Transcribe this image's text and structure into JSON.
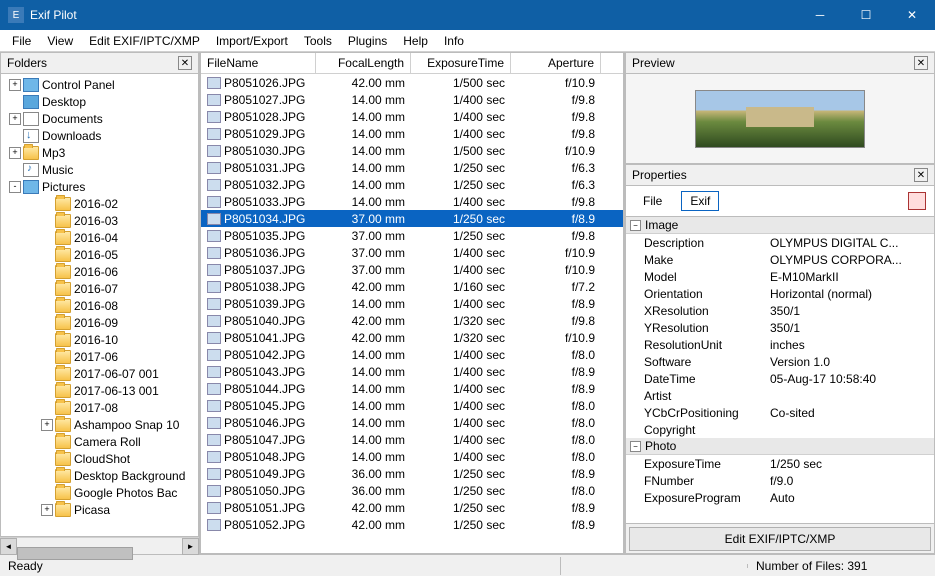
{
  "window": {
    "title": "Exif Pilot"
  },
  "menu": [
    "File",
    "View",
    "Edit EXIF/IPTC/XMP",
    "Import/Export",
    "Tools",
    "Plugins",
    "Help",
    "Info"
  ],
  "panels": {
    "folders_title": "Folders",
    "preview_title": "Preview",
    "properties_title": "Properties"
  },
  "tree": [
    {
      "depth": 0,
      "exp": "+",
      "icon": "cp",
      "label": "Control Panel"
    },
    {
      "depth": 0,
      "exp": "",
      "icon": "desk",
      "label": "Desktop"
    },
    {
      "depth": 0,
      "exp": "+",
      "icon": "doc",
      "label": "Documents"
    },
    {
      "depth": 0,
      "exp": "",
      "icon": "dl",
      "label": "Downloads"
    },
    {
      "depth": 0,
      "exp": "+",
      "icon": "folder",
      "label": "Mp3"
    },
    {
      "depth": 0,
      "exp": "",
      "icon": "music",
      "label": "Music"
    },
    {
      "depth": 0,
      "exp": "-",
      "icon": "pic",
      "label": "Pictures"
    },
    {
      "depth": 1,
      "exp": "",
      "icon": "folder",
      "label": "2016-02"
    },
    {
      "depth": 1,
      "exp": "",
      "icon": "folder",
      "label": "2016-03"
    },
    {
      "depth": 1,
      "exp": "",
      "icon": "folder",
      "label": "2016-04"
    },
    {
      "depth": 1,
      "exp": "",
      "icon": "folder",
      "label": "2016-05"
    },
    {
      "depth": 1,
      "exp": "",
      "icon": "folder",
      "label": "2016-06"
    },
    {
      "depth": 1,
      "exp": "",
      "icon": "folder",
      "label": "2016-07"
    },
    {
      "depth": 1,
      "exp": "",
      "icon": "folder",
      "label": "2016-08"
    },
    {
      "depth": 1,
      "exp": "",
      "icon": "folder",
      "label": "2016-09"
    },
    {
      "depth": 1,
      "exp": "",
      "icon": "folder",
      "label": "2016-10"
    },
    {
      "depth": 1,
      "exp": "",
      "icon": "folder",
      "label": "2017-06"
    },
    {
      "depth": 1,
      "exp": "",
      "icon": "folder",
      "label": "2017-06-07 001"
    },
    {
      "depth": 1,
      "exp": "",
      "icon": "folder",
      "label": "2017-06-13 001"
    },
    {
      "depth": 1,
      "exp": "",
      "icon": "folder",
      "label": "2017-08"
    },
    {
      "depth": 1,
      "exp": "+",
      "icon": "folder",
      "label": "Ashampoo Snap 10"
    },
    {
      "depth": 1,
      "exp": "",
      "icon": "folder",
      "label": "Camera Roll"
    },
    {
      "depth": 1,
      "exp": "",
      "icon": "folder",
      "label": "CloudShot"
    },
    {
      "depth": 1,
      "exp": "",
      "icon": "folder",
      "label": "Desktop Background"
    },
    {
      "depth": 1,
      "exp": "",
      "icon": "folder",
      "label": "Google Photos Bac"
    },
    {
      "depth": 1,
      "exp": "+",
      "icon": "folder",
      "label": "Picasa"
    }
  ],
  "columns": {
    "filename": "FileName",
    "focal": "FocalLength",
    "exposure": "ExposureTime",
    "aperture": "Aperture"
  },
  "files": [
    {
      "n": "P8051026.JPG",
      "f": "42.00 mm",
      "e": "1/500 sec",
      "a": "f/10.9"
    },
    {
      "n": "P8051027.JPG",
      "f": "14.00 mm",
      "e": "1/400 sec",
      "a": "f/9.8"
    },
    {
      "n": "P8051028.JPG",
      "f": "14.00 mm",
      "e": "1/400 sec",
      "a": "f/9.8"
    },
    {
      "n": "P8051029.JPG",
      "f": "14.00 mm",
      "e": "1/400 sec",
      "a": "f/9.8"
    },
    {
      "n": "P8051030.JPG",
      "f": "14.00 mm",
      "e": "1/500 sec",
      "a": "f/10.9"
    },
    {
      "n": "P8051031.JPG",
      "f": "14.00 mm",
      "e": "1/250 sec",
      "a": "f/6.3"
    },
    {
      "n": "P8051032.JPG",
      "f": "14.00 mm",
      "e": "1/250 sec",
      "a": "f/6.3"
    },
    {
      "n": "P8051033.JPG",
      "f": "14.00 mm",
      "e": "1/400 sec",
      "a": "f/9.8"
    },
    {
      "n": "P8051034.JPG",
      "f": "37.00 mm",
      "e": "1/250 sec",
      "a": "f/8.9",
      "sel": true
    },
    {
      "n": "P8051035.JPG",
      "f": "37.00 mm",
      "e": "1/250 sec",
      "a": "f/9.8"
    },
    {
      "n": "P8051036.JPG",
      "f": "37.00 mm",
      "e": "1/400 sec",
      "a": "f/10.9"
    },
    {
      "n": "P8051037.JPG",
      "f": "37.00 mm",
      "e": "1/400 sec",
      "a": "f/10.9"
    },
    {
      "n": "P8051038.JPG",
      "f": "42.00 mm",
      "e": "1/160 sec",
      "a": "f/7.2"
    },
    {
      "n": "P8051039.JPG",
      "f": "14.00 mm",
      "e": "1/400 sec",
      "a": "f/8.9"
    },
    {
      "n": "P8051040.JPG",
      "f": "42.00 mm",
      "e": "1/320 sec",
      "a": "f/9.8"
    },
    {
      "n": "P8051041.JPG",
      "f": "42.00 mm",
      "e": "1/320 sec",
      "a": "f/10.9"
    },
    {
      "n": "P8051042.JPG",
      "f": "14.00 mm",
      "e": "1/400 sec",
      "a": "f/8.0"
    },
    {
      "n": "P8051043.JPG",
      "f": "14.00 mm",
      "e": "1/400 sec",
      "a": "f/8.9"
    },
    {
      "n": "P8051044.JPG",
      "f": "14.00 mm",
      "e": "1/400 sec",
      "a": "f/8.9"
    },
    {
      "n": "P8051045.JPG",
      "f": "14.00 mm",
      "e": "1/400 sec",
      "a": "f/8.0"
    },
    {
      "n": "P8051046.JPG",
      "f": "14.00 mm",
      "e": "1/400 sec",
      "a": "f/8.0"
    },
    {
      "n": "P8051047.JPG",
      "f": "14.00 mm",
      "e": "1/400 sec",
      "a": "f/8.0"
    },
    {
      "n": "P8051048.JPG",
      "f": "14.00 mm",
      "e": "1/400 sec",
      "a": "f/8.0"
    },
    {
      "n": "P8051049.JPG",
      "f": "36.00 mm",
      "e": "1/250 sec",
      "a": "f/8.9"
    },
    {
      "n": "P8051050.JPG",
      "f": "36.00 mm",
      "e": "1/250 sec",
      "a": "f/8.0"
    },
    {
      "n": "P8051051.JPG",
      "f": "42.00 mm",
      "e": "1/250 sec",
      "a": "f/8.9"
    },
    {
      "n": "P8051052.JPG",
      "f": "42.00 mm",
      "e": "1/250 sec",
      "a": "f/8.9"
    }
  ],
  "props_toolbar": {
    "file": "File",
    "exif": "Exif"
  },
  "properties": {
    "categories": [
      {
        "name": "Image",
        "rows": [
          {
            "k": "Description",
            "v": "OLYMPUS DIGITAL C..."
          },
          {
            "k": "Make",
            "v": "OLYMPUS CORPORA..."
          },
          {
            "k": "Model",
            "v": "E-M10MarkII"
          },
          {
            "k": "Orientation",
            "v": "Horizontal (normal)"
          },
          {
            "k": "XResolution",
            "v": "350/1"
          },
          {
            "k": "YResolution",
            "v": "350/1"
          },
          {
            "k": "ResolutionUnit",
            "v": "inches"
          },
          {
            "k": "Software",
            "v": "Version 1.0"
          },
          {
            "k": "DateTime",
            "v": "05-Aug-17 10:58:40"
          },
          {
            "k": "Artist",
            "v": ""
          },
          {
            "k": "YCbCrPositioning",
            "v": "Co-sited"
          },
          {
            "k": "Copyright",
            "v": ""
          }
        ]
      },
      {
        "name": "Photo",
        "rows": [
          {
            "k": "ExposureTime",
            "v": "1/250 sec"
          },
          {
            "k": "FNumber",
            "v": "f/9.0"
          },
          {
            "k": "ExposureProgram",
            "v": "Auto"
          }
        ]
      }
    ]
  },
  "edit_button": "Edit EXIF/IPTC/XMP",
  "status": {
    "ready": "Ready",
    "filecount": "Number of Files: 391"
  }
}
